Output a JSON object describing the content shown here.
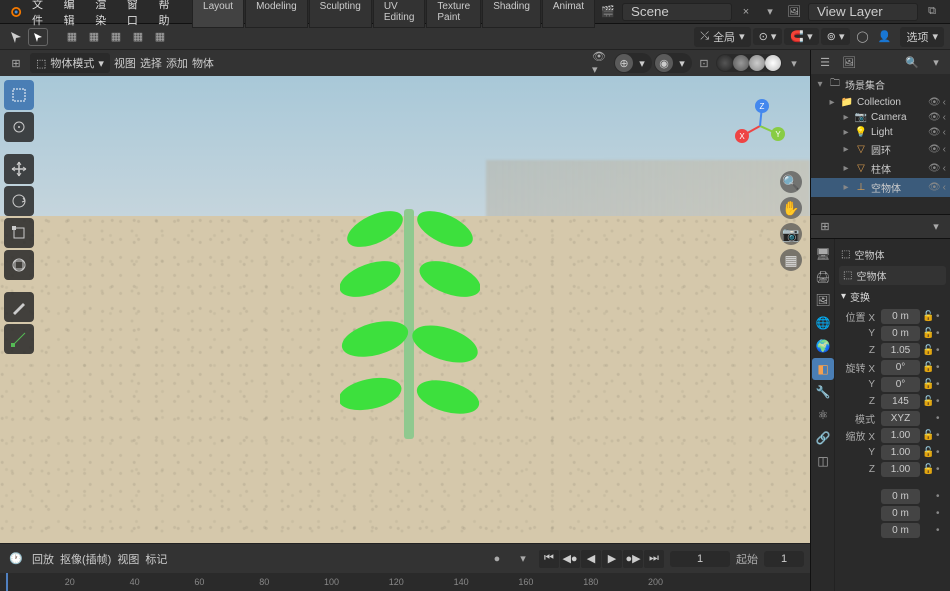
{
  "top_menu": {
    "items": [
      "文件",
      "编辑",
      "渲染",
      "窗口",
      "帮助"
    ],
    "tabs": [
      "Layout",
      "Modeling",
      "Sculpting",
      "UV Editing",
      "Texture Paint",
      "Shading",
      "Animat"
    ],
    "active_tab": 0,
    "scene_label": "Scene",
    "view_layer_label": "View Layer"
  },
  "tool_header": {
    "orientation": "全局",
    "options_label": "选项"
  },
  "viewport_header": {
    "mode": "物体模式",
    "menus": [
      "视图",
      "选择",
      "添加",
      "物体"
    ]
  },
  "outliner": {
    "title": "场景集合",
    "rows": [
      {
        "name": "Collection",
        "icon": "📁",
        "indent": 1
      },
      {
        "name": "Camera",
        "icon": "📷",
        "indent": 2,
        "color": "#e0a050"
      },
      {
        "name": "Light",
        "icon": "💡",
        "indent": 2,
        "color": "#e0a050"
      },
      {
        "name": "圆环",
        "icon": "▽",
        "indent": 2,
        "color": "#e0a050"
      },
      {
        "name": "柱体",
        "icon": "▽",
        "indent": 2,
        "color": "#e0a050"
      },
      {
        "name": "空物体",
        "icon": "⊥",
        "indent": 2,
        "selected": true,
        "color": "#e0a050"
      }
    ]
  },
  "properties": {
    "object_name": "空物体",
    "type_label": "空物体",
    "transform_label": "变换",
    "location_label": "位置",
    "rotation_label": "旋转",
    "scale_label": "缩放",
    "mode_label": "模式",
    "mode_value": "XYZ",
    "location": {
      "X": "0 m",
      "Y": "0 m",
      "Z": "1.05"
    },
    "rotation": {
      "X": "0°",
      "Y": "0°",
      "Z": "145"
    },
    "scale": {
      "X": "1.00",
      "Y": "1.00",
      "Z": "1.00"
    },
    "extra_values": [
      "0 m",
      "0 m",
      "0 m"
    ]
  },
  "timeline": {
    "playback_label": "回放",
    "keying_label": "抠像(插帧)",
    "view_label": "视图",
    "marker_label": "标记",
    "current_frame": "1",
    "start_label": "起始",
    "start_value": "1",
    "ticks": [
      "20",
      "40",
      "60",
      "80",
      "100",
      "120",
      "140",
      "160",
      "180",
      "200"
    ]
  }
}
